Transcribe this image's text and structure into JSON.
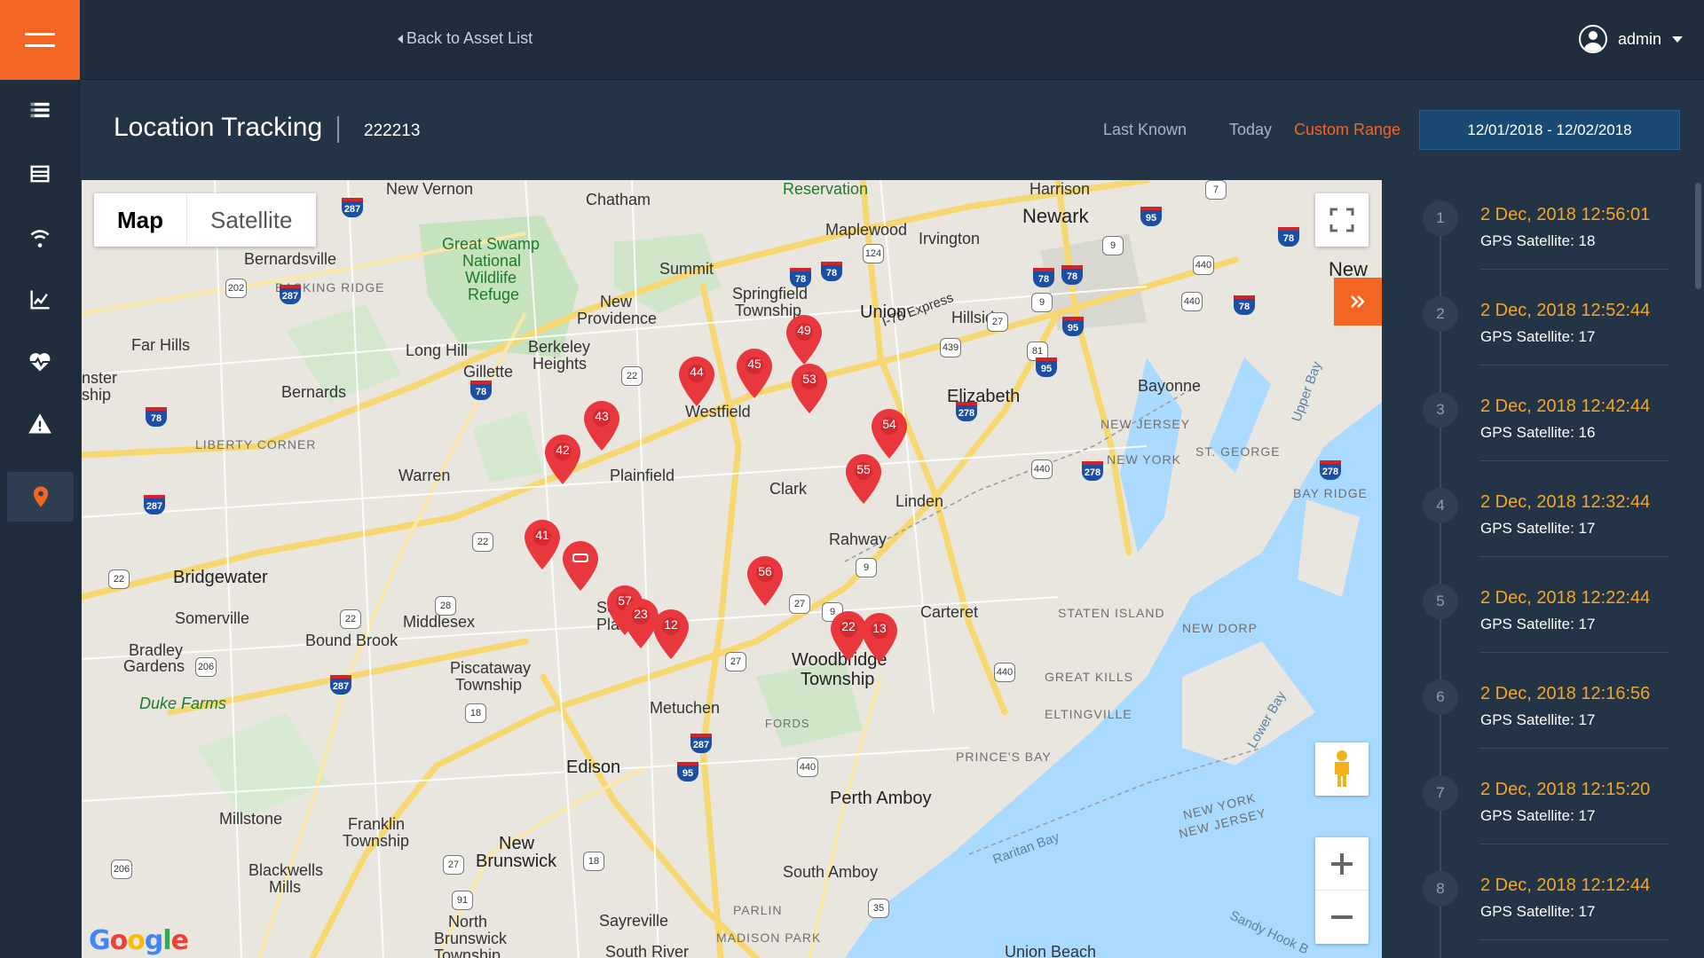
{
  "header": {
    "back_label": "Back to Asset List",
    "user_name": "admin"
  },
  "sidebar": {
    "items": [
      {
        "icon": "list-icon"
      },
      {
        "icon": "table-icon"
      },
      {
        "icon": "wifi-icon"
      },
      {
        "icon": "chart-line-icon"
      },
      {
        "icon": "heart-pulse-icon"
      },
      {
        "icon": "warning-icon"
      },
      {
        "icon": "location-pin-icon",
        "active": true
      }
    ]
  },
  "page": {
    "title": "Location Tracking",
    "asset_id": "222213",
    "range_options": {
      "last_known": "Last Known",
      "today": "Today",
      "custom_range": "Custom Range"
    },
    "date_range": "12/01/2018 - 12/02/2018"
  },
  "map": {
    "type_map": "Map",
    "type_satellite": "Satellite",
    "google": "Google",
    "pins": [
      "49",
      "44",
      "45",
      "53",
      "43",
      "42",
      "54",
      "55",
      "41",
      "",
      "56",
      "57",
      "23",
      "12",
      "22",
      "13"
    ],
    "labels": {
      "new_vernon": "New Vernon",
      "chatham": "Chatham",
      "reservation": "Reservation",
      "harrison": "Harrison",
      "newark": "Newark",
      "maplewood": "Maplewood",
      "irvington": "Irvington",
      "great_swamp": "Great Swamp",
      "national": "National",
      "wildlife": "Wildlife",
      "refuge": "Refuge",
      "summit": "Summit",
      "bernardsville": "Bernardsville",
      "basking_ridge": "BASKING RIDGE",
      "springfield": "Springfield",
      "township": "Township",
      "i78_express": "I-78 Express",
      "union": "Union",
      "hillside": "Hillside",
      "new_providence": "New",
      "new_providence2": "Providence",
      "far_hills": "Far Hills",
      "long_hill": "Long Hill",
      "berkeley": "Berkeley",
      "heights": "Heights",
      "gillette": "Gillette",
      "westfield": "Westfield",
      "elizabeth": "Elizabeth",
      "bayonne": "Bayonne",
      "bernards": "Bernards",
      "new_jersey_state": "NEW JERSEY",
      "new_york_state": "NEW YORK",
      "st_george": "ST. GEORGE",
      "liberty_corner": "LIBERTY CORNER",
      "plainfield": "Plainfield",
      "warren": "Warren",
      "clark": "Clark",
      "linden": "Linden",
      "rahway": "Rahway",
      "bay_ridge": "BAY RIDGE",
      "upper_bay": "Upper Bay",
      "bridgewater": "Bridgewater",
      "south_plainfield": "South",
      "south_plainfield2": "Plainfield",
      "somerville": "Somerville",
      "middlesex": "Middlesex",
      "bound_brook": "Bound Brook",
      "carteret": "Carteret",
      "staten_island": "STATEN ISLAND",
      "new_dorp": "NEW DORP",
      "bradley": "Bradley",
      "gardens": "Gardens",
      "piscataway": "Piscataway",
      "piscataway2": "Township",
      "woodbridge": "Woodbridge",
      "woodbridge2": "Township",
      "great_kills": "GREAT KILLS",
      "eltingville": "ELTINGVILLE",
      "metuchen": "Metuchen",
      "duke_farms": "Duke Farms",
      "fords": "FORDS",
      "princes_bay": "PRINCE'S BAY",
      "edison": "Edison",
      "lower_bay": "Lower Bay",
      "perth_amboy": "Perth Amboy",
      "millstone": "Millstone",
      "franklin": "Franklin",
      "franklin2": "Township",
      "ny_nj": "NEW YORK",
      "ny_nj2": "NEW JERSEY",
      "new_brunswick": "New",
      "new_brunswick2": "Brunswick",
      "blackwells": "Blackwells",
      "mills": "Mills",
      "raritan_bay": "Raritan Bay",
      "south_amboy": "South Amboy",
      "parlin": "PARLIN",
      "sayreville": "Sayreville",
      "madison_park": "MADISON PARK",
      "north": "North",
      "north2": "Brunswick",
      "north3": "Township",
      "south_river": "South River",
      "union_beach": "Union Beach",
      "sandy_hook": "Sandy Hook B",
      "new_city": "New",
      "ship": "nster",
      "ship2": "ship",
      "hill": "Hill"
    }
  },
  "timeline": [
    {
      "num": "1",
      "time": "2 Dec, 2018 12:56:01",
      "sat": "GPS Satellite: 18"
    },
    {
      "num": "2",
      "time": "2 Dec, 2018 12:52:44",
      "sat": "GPS Satellite: 17"
    },
    {
      "num": "3",
      "time": "2 Dec, 2018 12:42:44",
      "sat": "GPS Satellite: 16"
    },
    {
      "num": "4",
      "time": "2 Dec, 2018 12:32:44",
      "sat": "GPS Satellite: 17"
    },
    {
      "num": "5",
      "time": "2 Dec, 2018 12:22:44",
      "sat": "GPS Satellite: 17"
    },
    {
      "num": "6",
      "time": "2 Dec, 2018 12:16:56",
      "sat": "GPS Satellite: 17"
    },
    {
      "num": "7",
      "time": "2 Dec, 2018 12:15:20",
      "sat": "GPS Satellite: 17"
    },
    {
      "num": "8",
      "time": "2 Dec, 2018 12:12:44",
      "sat": "GPS Satellite: 17"
    }
  ],
  "colors": {
    "accent": "#f26522",
    "time_text": "#f5a623",
    "date_button": "#1a4a73",
    "pin": "#e8383d"
  }
}
